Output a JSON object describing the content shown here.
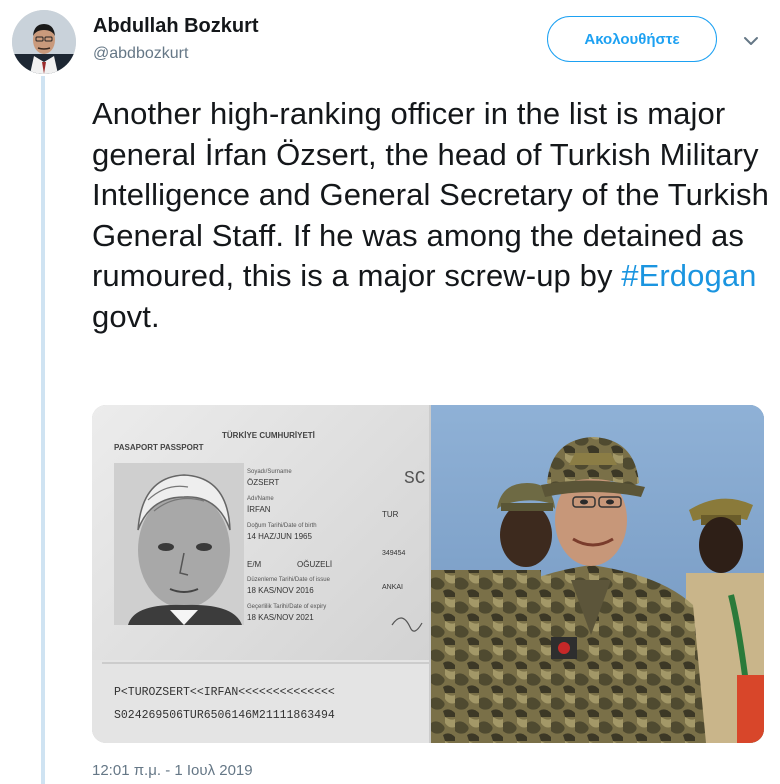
{
  "author": {
    "name": "Abdullah Bozkurt",
    "handle": "@abdbozkurt"
  },
  "follow_label": "Ακολουθήστε",
  "tweet": {
    "text_before": "Another high-ranking officer in the list is major general  İrfan Özsert, the head of Turkish Military Intelligence and General Secretary of the Turkish General Staff. If he was among the detained as rumoured, this is a major screw-up by ",
    "hashtag": "#Erdogan",
    "text_after": " govt."
  },
  "passport": {
    "header_left": "PASAPORT PASSPORT",
    "header_right": "TÜRKİYE CUMHURİYETİ",
    "surname_label": "Soyadı/Surname",
    "surname": "ÖZSERT",
    "given_label": "Adı/Name",
    "given": "İRFAN",
    "dob_label": "Doğum Tarihi/Date of birth",
    "dob": "14 HAZ/JUN 1965",
    "sex": "E/M",
    "pob": "OĞUZELİ",
    "issue_label": "Düzenleme Tarihi/Date of issue",
    "issue": "18 KAS/NOV 2016",
    "expiry_label": "Geçerlilik Tarihi/Date of expiry",
    "expiry": "18 KAS/NOV 2021",
    "nat": "TUR",
    "mrz1": "P<TUROZSERT<<IRFAN<<<<<<<<<<<<<<",
    "mrz2": "S024269506TUR6506146M21111863494"
  },
  "timestamp": "12:01 π.μ. - 1 Ιουλ 2019",
  "icons": [
    "chevron-down-icon",
    "avatar"
  ],
  "colors": {
    "accent": "#1da1f2",
    "hashtag": "#1b95e0",
    "muted": "#657786",
    "thread": "#cfe3f2"
  }
}
